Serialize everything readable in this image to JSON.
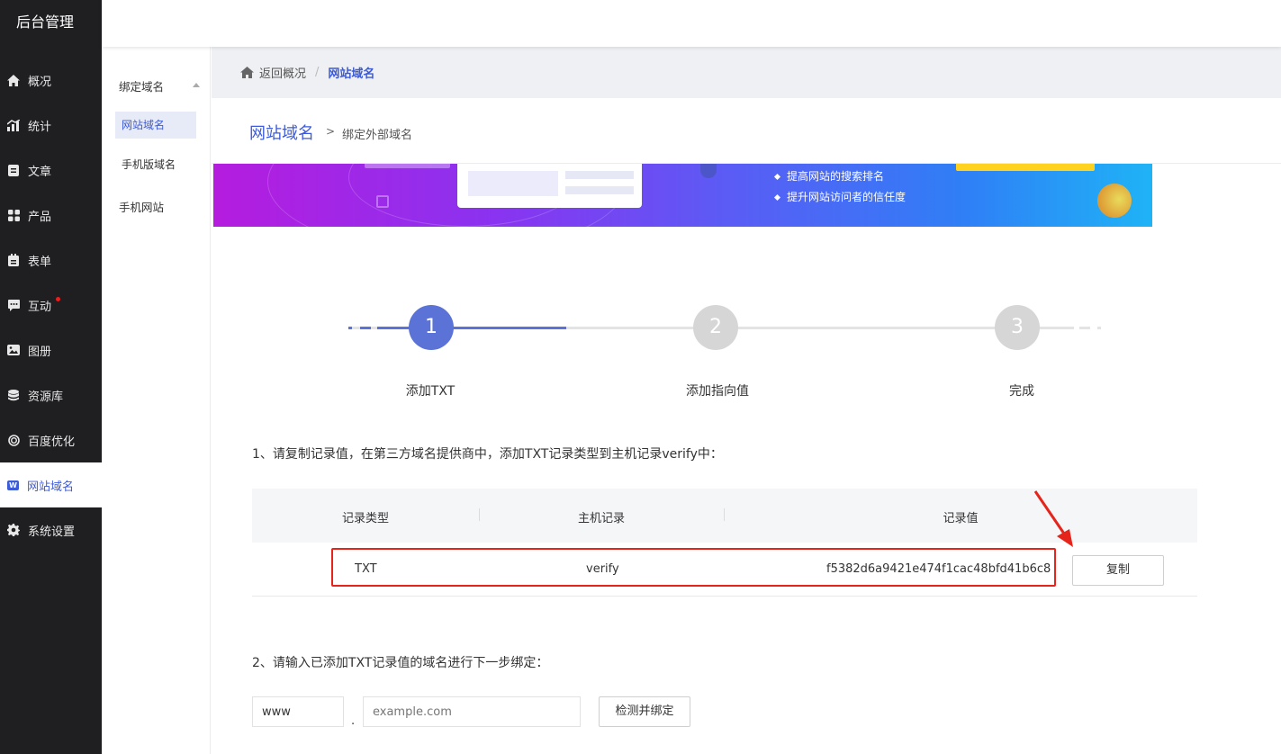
{
  "app": {
    "title": "后台管理"
  },
  "sidebar": {
    "items": [
      {
        "label": "概况",
        "icon": "home-icon"
      },
      {
        "label": "统计",
        "icon": "chart-icon"
      },
      {
        "label": "文章",
        "icon": "article-icon"
      },
      {
        "label": "产品",
        "icon": "grid-icon"
      },
      {
        "label": "表单",
        "icon": "clipboard-icon"
      },
      {
        "label": "互动",
        "icon": "chat-icon",
        "badge": true
      },
      {
        "label": "图册",
        "icon": "album-icon"
      },
      {
        "label": "资源库",
        "icon": "database-icon"
      },
      {
        "label": "百度优化",
        "icon": "target-icon"
      },
      {
        "label": "网站域名",
        "icon": "w-icon",
        "active": true,
        "icon_text": "W"
      },
      {
        "label": "系统设置",
        "icon": "gear-icon"
      }
    ]
  },
  "subnav": {
    "group": "绑定域名",
    "items": [
      "网站域名",
      "手机版域名"
    ],
    "extra": "手机网站"
  },
  "breadcrumb": {
    "home": "返回概况",
    "sep": "/",
    "current": "网站域名"
  },
  "page": {
    "title": "网站域名",
    "arrow": ">",
    "subtitle": "绑定外部域名"
  },
  "banner": {
    "bullets": [
      "提高网站的搜索排名",
      "提升网站访问者的信任度"
    ]
  },
  "steps": [
    {
      "num": "1",
      "label": "添加TXT",
      "state": "active"
    },
    {
      "num": "2",
      "label": "添加指向值",
      "state": "pending"
    },
    {
      "num": "3",
      "label": "完成",
      "state": "pending"
    }
  ],
  "step_progress": 0.25,
  "colors": {
    "accent": "#3d5bd6",
    "step_active": "#5b72d6",
    "step_pending": "#d6d6d6",
    "highlight": "#e5241b",
    "sidebar_bg": "#1f1f22"
  },
  "instruction1": "1、请复制记录值，在第三方域名提供商中，添加TXT记录类型到主机记录verify中：",
  "table": {
    "headers": [
      "记录类型",
      "主机记录",
      "记录值"
    ],
    "row": {
      "type": "TXT",
      "host": "verify",
      "value": "f5382d6a9421e474f1cac48bfd41b6c8"
    },
    "copy_label": "复制"
  },
  "instruction2": "2、请输入已添加TXT记录值的域名进行下一步绑定：",
  "form": {
    "prefix_value": "www",
    "dot": ".",
    "domain_placeholder": "example.com",
    "submit_label": "检测并绑定"
  }
}
